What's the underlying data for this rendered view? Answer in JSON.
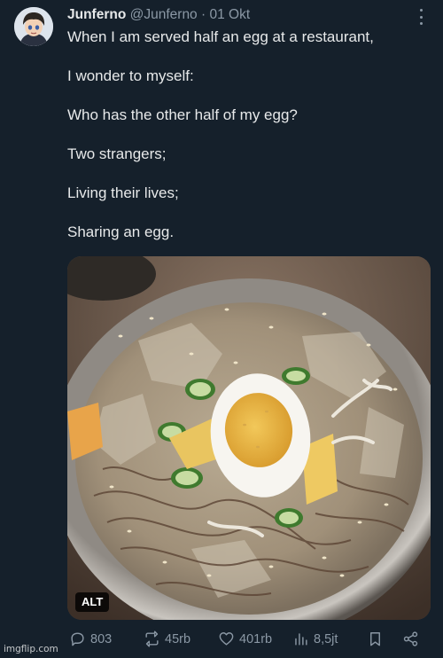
{
  "author": {
    "name": "Junferno",
    "handle": "@Junferno",
    "date": "01 Okt"
  },
  "separator": "·",
  "tweet_lines": [
    "When I am served half an egg at a restaurant,",
    "I wonder to myself:",
    "Who has the other half of my egg?",
    "Two strangers;",
    "Living their lives;",
    "Sharing an egg."
  ],
  "media": {
    "alt_badge": "ALT"
  },
  "actions": {
    "replies": "803",
    "reposts": "45rb",
    "likes": "401rb",
    "views": "8,5jt"
  },
  "watermark": "imgflip.com",
  "colors": {
    "background": "#15202b",
    "text": "#e7e9ea",
    "muted": "#8b98a5"
  }
}
